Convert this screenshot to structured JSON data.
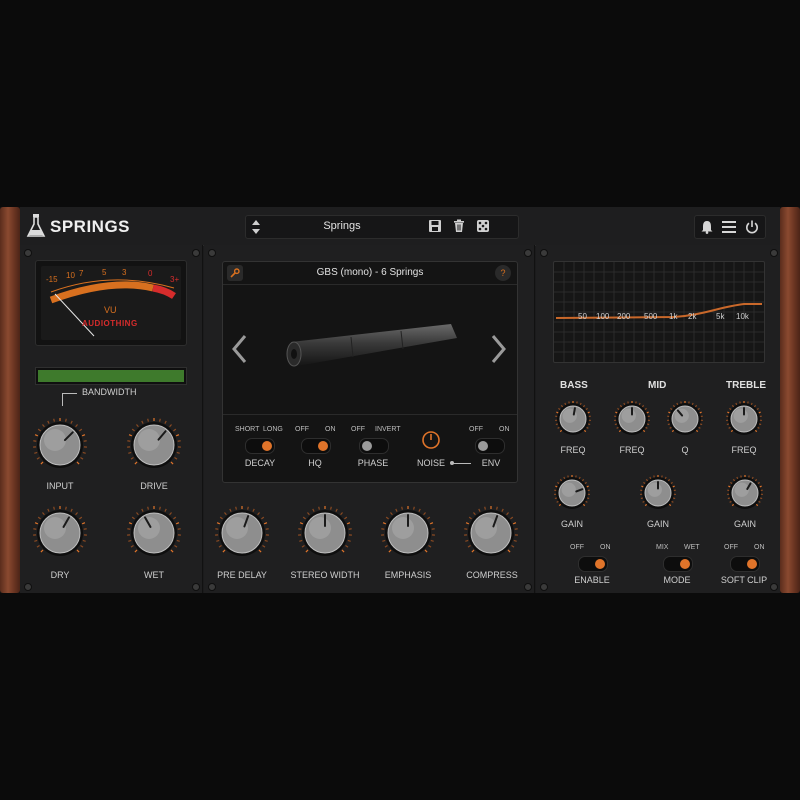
{
  "app": {
    "title": "SPRINGS"
  },
  "preset": {
    "name": "Springs"
  },
  "vu": {
    "scale": [
      "-15",
      "10",
      "7",
      "5",
      "3",
      "0",
      "3+"
    ],
    "unit": "VU",
    "brand": "AUDIOTHING"
  },
  "left": {
    "bandwidth_label": "BANDWIDTH",
    "input": "INPUT",
    "drive": "DRIVE",
    "dry": "DRY",
    "wet": "WET"
  },
  "display": {
    "title": "GBS (mono) - 6 Springs",
    "help": "?"
  },
  "switches": {
    "decay": {
      "off": "SHORT",
      "on": "LONG",
      "label": "DECAY"
    },
    "hq": {
      "off": "OFF",
      "on": "ON",
      "label": "HQ"
    },
    "phase": {
      "off": "OFF",
      "on": "INVERT",
      "label": "PHASE"
    },
    "noise": {
      "label": "NOISE"
    },
    "env": {
      "off": "OFF",
      "on": "ON",
      "label": "ENV"
    }
  },
  "mid": {
    "pre_delay": "PRE DELAY",
    "stereo_width": "STEREO WIDTH",
    "emphasis": "EMPHASIS",
    "compress": "COMPRESS"
  },
  "eq": {
    "freq_ticks": [
      "50",
      "100",
      "200",
      "500",
      "1k",
      "2k",
      "5k",
      "10k"
    ],
    "bass": "BASS",
    "mid": "MID",
    "treble": "TREBLE",
    "freq": "FREQ",
    "q": "Q",
    "gain": "GAIN",
    "enable": {
      "off": "OFF",
      "on": "ON",
      "label": "ENABLE"
    },
    "mode": {
      "off": "MIX",
      "on": "WET",
      "label": "MODE"
    },
    "soft_clip": {
      "off": "OFF",
      "on": "ON",
      "label": "SOFT CLIP"
    }
  },
  "colors": {
    "accent": "#e0742a",
    "panel": "#1f1f20",
    "meter_green": "#3e7a2c",
    "wood": "#7a3f28"
  },
  "icons": [
    "flask-icon",
    "updown-arrows-icon",
    "save-icon",
    "trash-icon",
    "dice-icon",
    "bell-icon",
    "menu-icon",
    "power-icon",
    "wrench-icon",
    "help-icon",
    "chevron-left-icon",
    "chevron-right-icon"
  ]
}
